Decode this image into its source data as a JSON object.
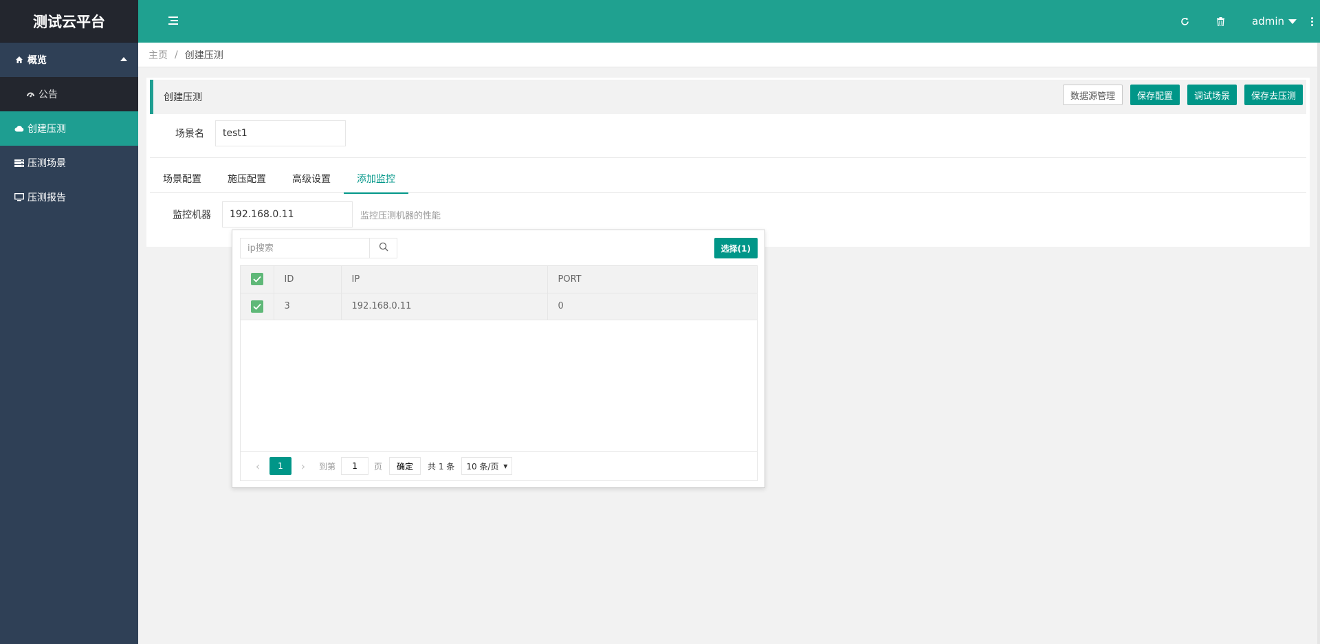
{
  "app": {
    "title": "测试云平台"
  },
  "sidebar": {
    "items": [
      {
        "label": "概览",
        "icon": "home-icon"
      },
      {
        "label": "公告",
        "icon": "dashboard-icon"
      },
      {
        "label": "创建压测",
        "icon": "cloud-icon"
      },
      {
        "label": "压测场景",
        "icon": "server-icon"
      },
      {
        "label": "压测报告",
        "icon": "monitor-icon"
      }
    ]
  },
  "header": {
    "user": "admin"
  },
  "breadcrumb": {
    "home": "主页",
    "separator": "/",
    "current": "创建压测"
  },
  "card": {
    "title": "创建压测",
    "buttons": {
      "datasource": "数据源管理",
      "save_config": "保存配置",
      "debug": "调试场景",
      "save_run": "保存去压测"
    }
  },
  "scene": {
    "label": "场景名",
    "value": "test1"
  },
  "tabs": [
    "场景配置",
    "施压配置",
    "高级设置",
    "添加监控"
  ],
  "monitor": {
    "label": "监控机器",
    "value": "192.168.0.11",
    "hint": "监控压测机器的性能"
  },
  "dropdown": {
    "search_placeholder": "ip搜索",
    "select_button": "选择(1)",
    "columns": [
      "ID",
      "IP",
      "PORT"
    ],
    "rows": [
      {
        "id": "3",
        "ip": "192.168.0.11",
        "port": "0"
      }
    ],
    "pager": {
      "current": "1",
      "goto_label": "到第",
      "goto_value": "1",
      "page_unit": "页",
      "ok": "确定",
      "total": "共 1 条",
      "page_size": "10 条/页"
    }
  },
  "colors": {
    "sidebar": "#2f4056",
    "header": "#1fa190",
    "primary": "#009688",
    "checkbox": "#5fb878"
  }
}
